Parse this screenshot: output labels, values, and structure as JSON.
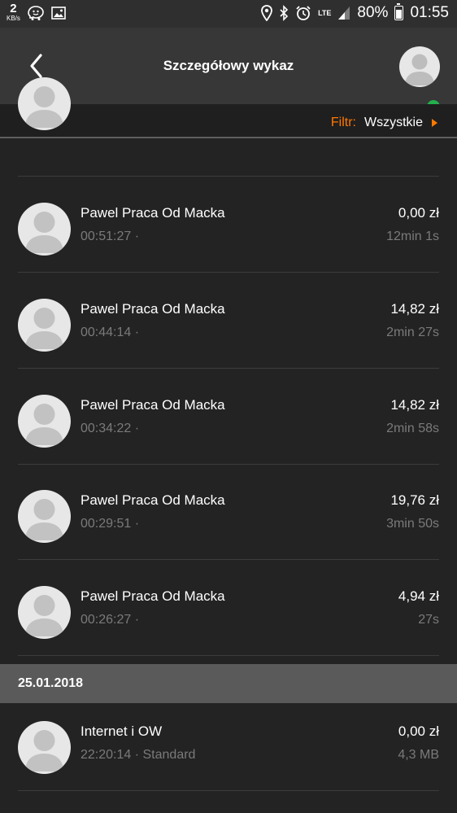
{
  "status_bar": {
    "kbs_value": "2",
    "kbs_unit": "KB/s",
    "lte": "LTE",
    "battery_percent": "80%",
    "time": "01:55"
  },
  "header": {
    "title": "Szczegółowy wykaz"
  },
  "filter": {
    "label": "Filtr:",
    "value": "Wszystkie"
  },
  "calls": [
    {
      "name": "Pawel Praca Od Macka",
      "time": "00:51:27 ·",
      "amount": "0,00 zł",
      "duration": "12min 1s"
    },
    {
      "name": "Pawel Praca Od Macka",
      "time": "00:44:14 ·",
      "amount": "14,82 zł",
      "duration": "2min 27s"
    },
    {
      "name": "Pawel Praca Od Macka",
      "time": "00:34:22 ·",
      "amount": "14,82 zł",
      "duration": "2min 58s"
    },
    {
      "name": "Pawel Praca Od Macka",
      "time": "00:29:51 ·",
      "amount": "19,76 zł",
      "duration": "3min 50s"
    },
    {
      "name": "Pawel Praca Od Macka",
      "time": "00:26:27 ·",
      "amount": "4,94 zł",
      "duration": "27s"
    }
  ],
  "date_section": {
    "date": "25.01.2018"
  },
  "data_entries": [
    {
      "name": "Internet i OW",
      "time": "22:20:14 · Standard",
      "amount": "0,00 zł",
      "duration": "4,3 MB"
    }
  ],
  "colors": {
    "accent": "#ff7900",
    "online": "#22b14c",
    "background": "#232323"
  }
}
